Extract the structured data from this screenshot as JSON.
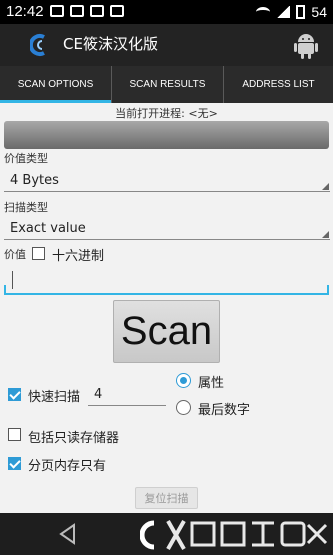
{
  "status_bar": {
    "time": "12:42",
    "battery": "54"
  },
  "app": {
    "title": "CE筱沫汉化版"
  },
  "tabs": [
    {
      "label": "SCAN OPTIONS",
      "active": true
    },
    {
      "label": "SCAN RESULTS",
      "active": false
    },
    {
      "label": "ADDRESS LIST",
      "active": false
    }
  ],
  "process": {
    "label": "当前打开进程: <无>"
  },
  "value_type": {
    "label": "价值类型",
    "selected": "4 Bytes"
  },
  "scan_type": {
    "label": "扫描类型",
    "selected": "Exact value"
  },
  "value": {
    "label": "价值",
    "hex_label": "十六进制",
    "hex_checked": false,
    "input_value": ""
  },
  "scan_button": {
    "label": "Scan"
  },
  "fast_scan": {
    "label": "快速扫描",
    "checked": true,
    "value": "4"
  },
  "alignment": {
    "options": [
      {
        "label": "属性",
        "checked": true
      },
      {
        "label": "最后数字",
        "checked": false
      }
    ]
  },
  "readonly_memory": {
    "label": "包括只读存储器",
    "checked": false
  },
  "paged_memory": {
    "label": "分页内存只有",
    "checked": true
  },
  "reset_button": {
    "label": "复位扫描"
  },
  "accent_color": "#33b5e5",
  "icons": [
    "wifi-icon",
    "signal-icon",
    "battery-icon",
    "android-icon",
    "back-icon",
    "app-logo-icon"
  ]
}
